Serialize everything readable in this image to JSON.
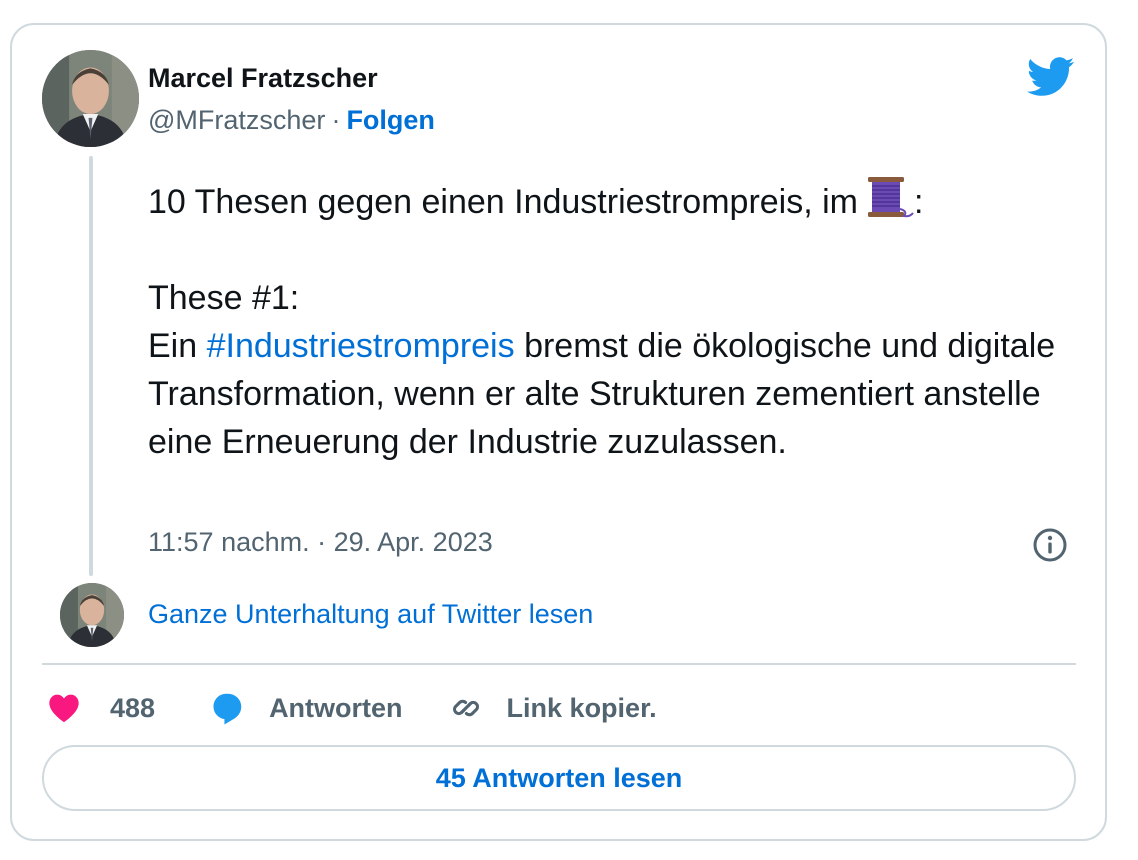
{
  "author": {
    "name": "Marcel Fratzscher",
    "handle": "@MFratzscher",
    "separator": "·",
    "follow_label": "Folgen"
  },
  "icons": {
    "brand": "twitter-bird-icon",
    "thread_emoji": "spool-of-thread-icon",
    "info": "info-icon",
    "like": "heart-icon",
    "reply": "speech-bubble-icon",
    "copy_link": "link-icon"
  },
  "tweet": {
    "line1": "10 Thesen gegen einen Industriestrompreis, im",
    "line1_suffix": ":",
    "these_heading": "These #1:",
    "body_prefix": "Ein",
    "hashtag": "#Industriestrompreis",
    "body_rest": "bremst die ökologische und digitale Transformation, wenn er alte Strukturen zementiert anstelle eine Erneuerung der Industrie zuzulassen."
  },
  "timestamp": "11:57 nachm. · 29. Apr. 2023",
  "read_conversation": "Ganze Unterhaltung auf Twitter lesen",
  "actions": {
    "likes": "488",
    "reply_label": "Antworten",
    "copy_link_label": "Link kopier."
  },
  "read_replies_button": "45 Antworten lesen",
  "colors": {
    "text": "#0f1419",
    "secondary": "#536471",
    "link": "#006fd6",
    "twitter_blue": "#1d9bf0",
    "like": "#f91880",
    "border": "#cfd9de"
  }
}
